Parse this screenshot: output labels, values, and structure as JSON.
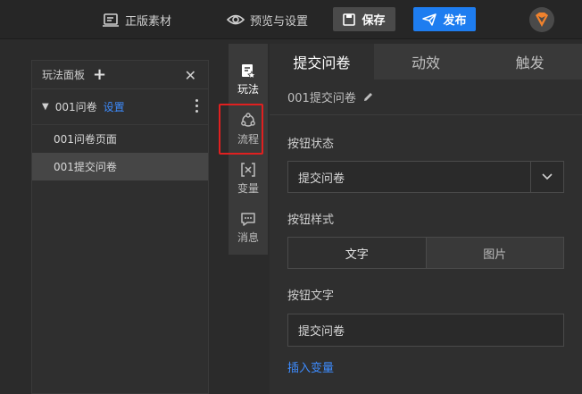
{
  "toolbar": {
    "licensed_assets": "正版素材",
    "preview_settings": "预览与设置",
    "save": "保存",
    "publish": "发布"
  },
  "left_panel": {
    "title": "玩法面板",
    "add": "+",
    "close": "✕",
    "group": {
      "name": "001问卷",
      "settings_link": "设置",
      "items": [
        {
          "label": "001问卷页面"
        },
        {
          "label": "001提交问卷"
        }
      ],
      "selected_index": 1
    }
  },
  "side_nav": {
    "items": [
      {
        "label": "玩法",
        "icon": "gameplay-icon"
      },
      {
        "label": "流程",
        "icon": "flow-icon"
      },
      {
        "label": "变量",
        "icon": "variable-icon"
      },
      {
        "label": "消息",
        "icon": "message-icon"
      }
    ],
    "active_index": 0,
    "highlighted_index": 1
  },
  "properties": {
    "tabs": [
      {
        "label": "提交问卷"
      },
      {
        "label": "动效"
      },
      {
        "label": "触发"
      }
    ],
    "active_tab": 0,
    "component_name": "001提交问卷",
    "button_state_label": "按钮状态",
    "button_state_value": "提交问卷",
    "button_style_label": "按钮样式",
    "style_options": [
      {
        "label": "文字"
      },
      {
        "label": "图片"
      }
    ],
    "selected_style": 0,
    "button_text_label": "按钮文字",
    "button_text_value": "提交问卷",
    "insert_variable": "插入变量"
  },
  "colors": {
    "accent": "#1e7df0",
    "link": "#3d8bfd",
    "highlight_box": "#e02020"
  }
}
